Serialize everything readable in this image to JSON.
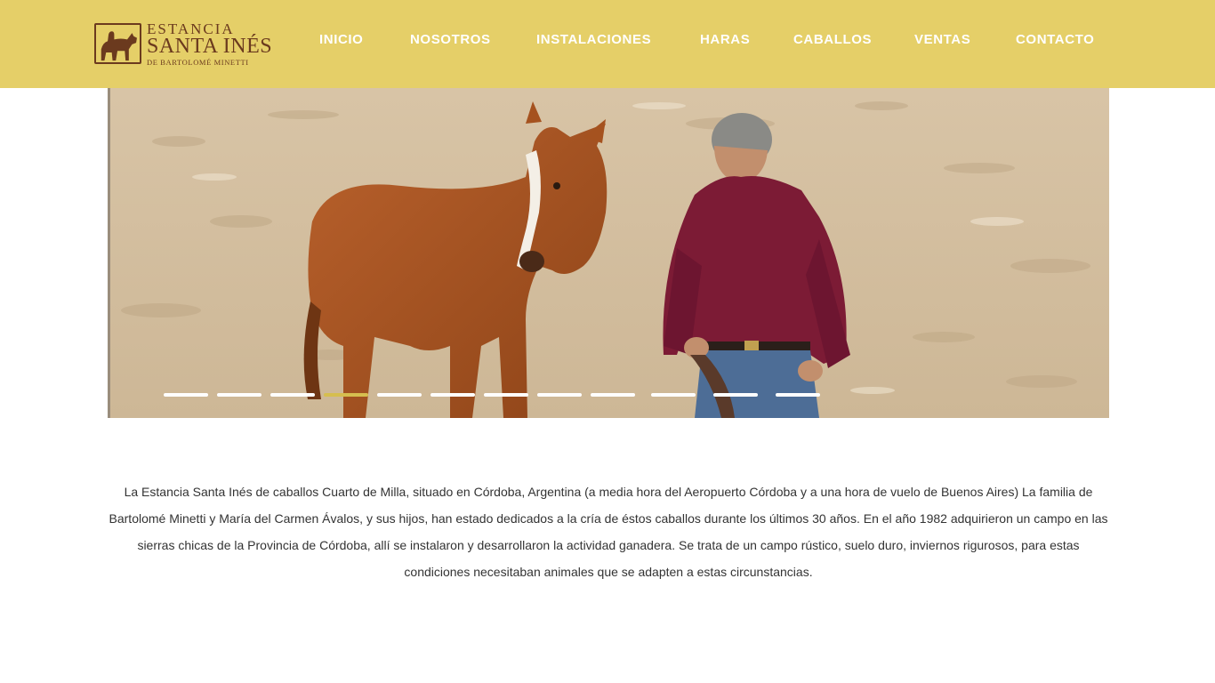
{
  "brand": {
    "line1": "ESTANCIA",
    "line2": "SANTA INÉS",
    "line3": "DE BARTOLOMÉ MINETTI",
    "color": "#6b3a1e"
  },
  "header": {
    "background": "#e5cf68"
  },
  "nav": {
    "items": [
      {
        "label": "INICIO"
      },
      {
        "label": "NOSOTROS"
      },
      {
        "label": "INSTALACIONES"
      },
      {
        "label": "HARAS"
      },
      {
        "label": "CABALLOS"
      },
      {
        "label": "VENTAS"
      },
      {
        "label": "CONTACTO"
      }
    ]
  },
  "slider": {
    "slide_count": 12,
    "active_index": 3,
    "active_color": "#d6be4f"
  },
  "intro": {
    "text": "La Estancia Santa Inés de caballos Cuarto de Milla, situado en Córdoba, Argentina (a media hora del Aeropuerto Córdoba y a una hora de vuelo de Buenos Aires) La familia de Bartolomé Minetti y María del Carmen Ávalos, y sus hijos, han estado dedicados a la cría de éstos caballos durante los últimos 30 años. En el año 1982 adquirieron un campo en las sierras chicas de la Provincia de Córdoba, allí se instalaron y desarrollaron la actividad ganadera. Se trata de un campo rústico, suelo duro, inviernos rigurosos, para estas condiciones necesitaban animales que se adapten a estas circunstancias."
  }
}
